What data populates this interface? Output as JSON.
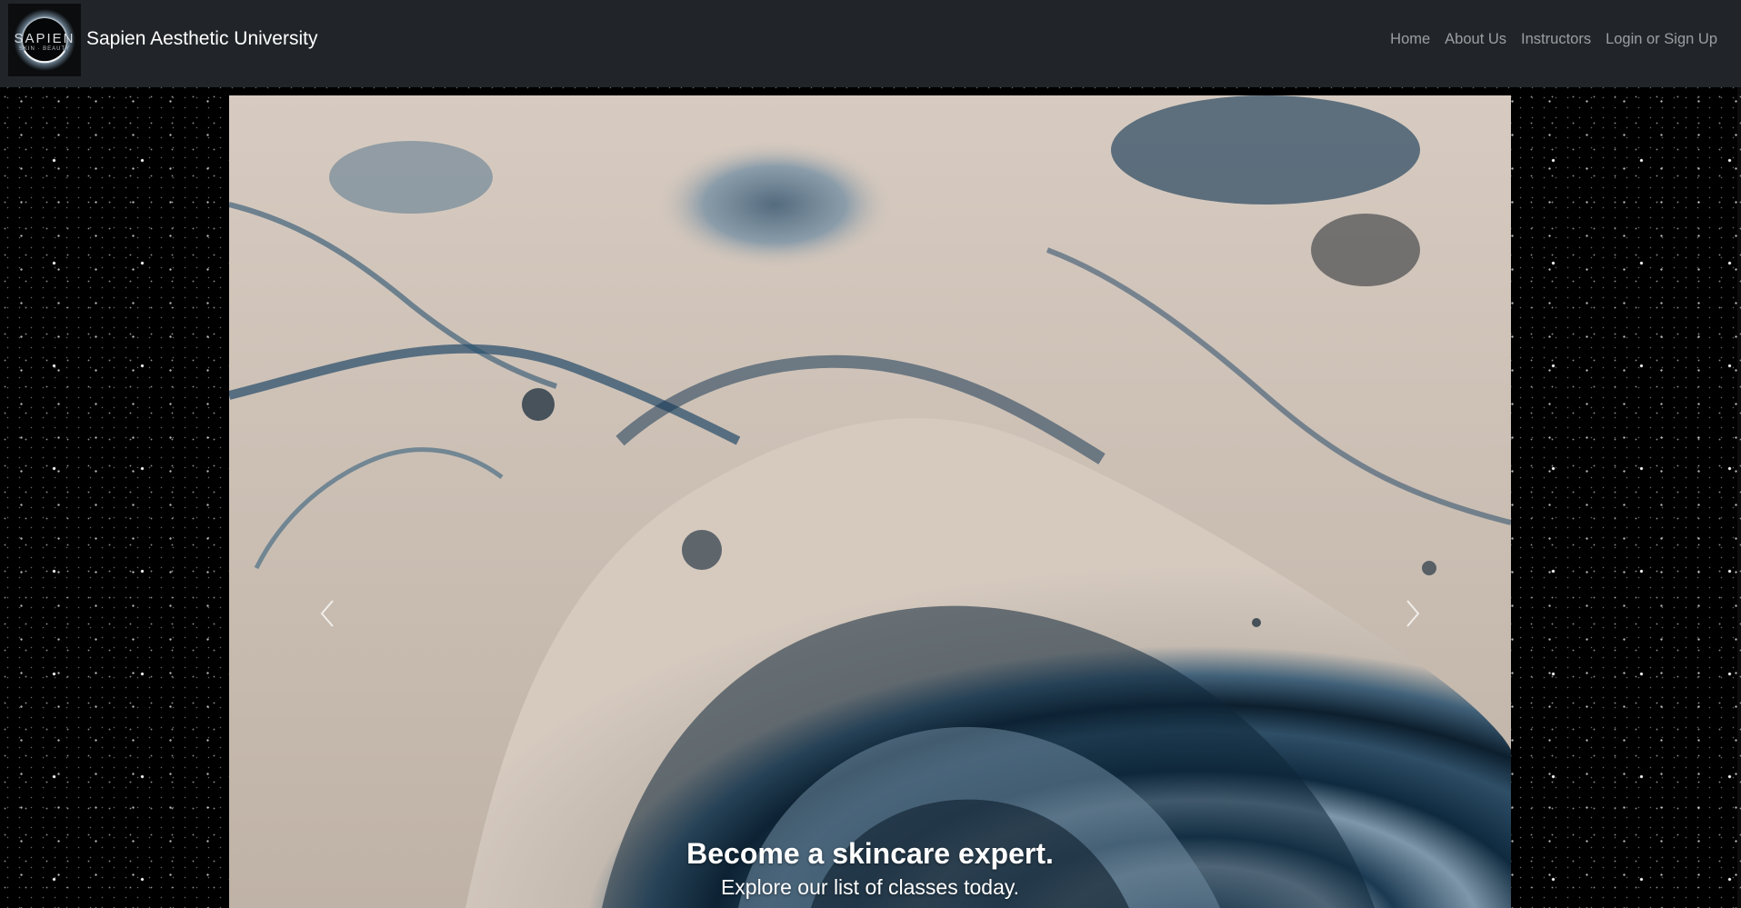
{
  "navbar": {
    "brand": {
      "logo_text": "SAPIEN",
      "logo_subtext": "SKIN · BEAUTY",
      "title": "Sapien Aesthetic University"
    },
    "links": [
      {
        "label": "Home"
      },
      {
        "label": "About Us"
      },
      {
        "label": "Instructors"
      },
      {
        "label": "Login or Sign Up"
      }
    ]
  },
  "carousel": {
    "prev_icon": "chevron-left-icon",
    "next_icon": "chevron-right-icon",
    "caption": {
      "title": "Become a skincare expert.",
      "subtitle": "Explore our list of classes today."
    }
  },
  "colors": {
    "navbar_bg": "#212529",
    "page_bg": "#000000",
    "nav_link": "rgba(255,255,255,0.55)",
    "brand_text": "#ffffff"
  }
}
